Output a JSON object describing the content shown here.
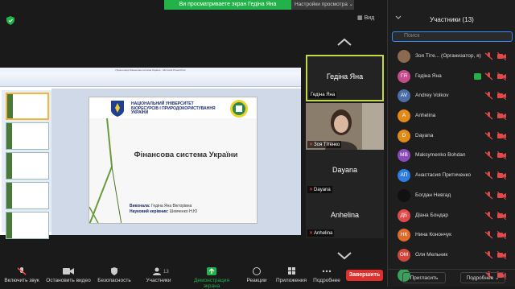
{
  "banner": {
    "share_text": "Ви просматриваете экран Гедіна Яна",
    "view_options": "Настройки просмотра ⌄",
    "view": "Вид"
  },
  "ppt": {
    "title": "Презентація Фінансова система України - Microsoft PowerPoint"
  },
  "slide": {
    "university": "Національний університет біоресурсів і природокористування України",
    "title": "Фінансова система України",
    "author_label": "Виконала:",
    "author": "Гедіна Яна Вікторівна",
    "advisor_label": "Науковий керівник:",
    "advisor": "Шевченко Н.Ю"
  },
  "tiles": [
    {
      "name": "Гедіна Яна",
      "label": "Гедіна Яна"
    },
    {
      "label": "Зоя Тітенко"
    },
    {
      "name": "Dayana",
      "label": "Dayana"
    },
    {
      "name": "Anhelina",
      "label": "Anhelina"
    }
  ],
  "toolbar": {
    "mute": "Включить звук",
    "video": "Остановить видео",
    "security": "Безопасность",
    "participants": "Участники",
    "participants_count": "13",
    "share": "Демонстрация экрана",
    "reactions": "Реакции",
    "apps": "Приложения",
    "more": "Подробнее",
    "end": "Завершить"
  },
  "panel": {
    "title": "Участники (13)",
    "search_placeholder": "Поиск",
    "invite": "Пригласить",
    "more": "Подробнее ⌄",
    "participants": [
      {
        "initials": "",
        "name": "Зоя Тіте... (Организатор, я)",
        "color": "#8a6a50"
      },
      {
        "initials": "ГЯ",
        "name": "Гедіна Яна",
        "color": "#c44b8c"
      },
      {
        "initials": "AV",
        "name": "Andrey Volkov",
        "color": "#4a6fa8"
      },
      {
        "initials": "A",
        "name": "Anhelina",
        "color": "#e08a1a"
      },
      {
        "initials": "D",
        "name": "Dayana",
        "color": "#e08a1a"
      },
      {
        "initials": "MB",
        "name": "Maksymenko Bohdan",
        "color": "#8a4ab8"
      },
      {
        "initials": "АП",
        "name": "Анастасия Притиченко",
        "color": "#2d7de0"
      },
      {
        "initials": "",
        "name": "Богдан Невгад",
        "color": "#111111"
      },
      {
        "initials": "ДБ",
        "name": "Діана Бондар",
        "color": "#e04a4a"
      },
      {
        "initials": "НК",
        "name": "Нина Конончук",
        "color": "#e06a2a"
      },
      {
        "initials": "ОМ",
        "name": "Оля Мельник",
        "color": "#d0463a"
      },
      {
        "initials": "",
        "name": "",
        "color": "#3aa05a"
      }
    ]
  }
}
